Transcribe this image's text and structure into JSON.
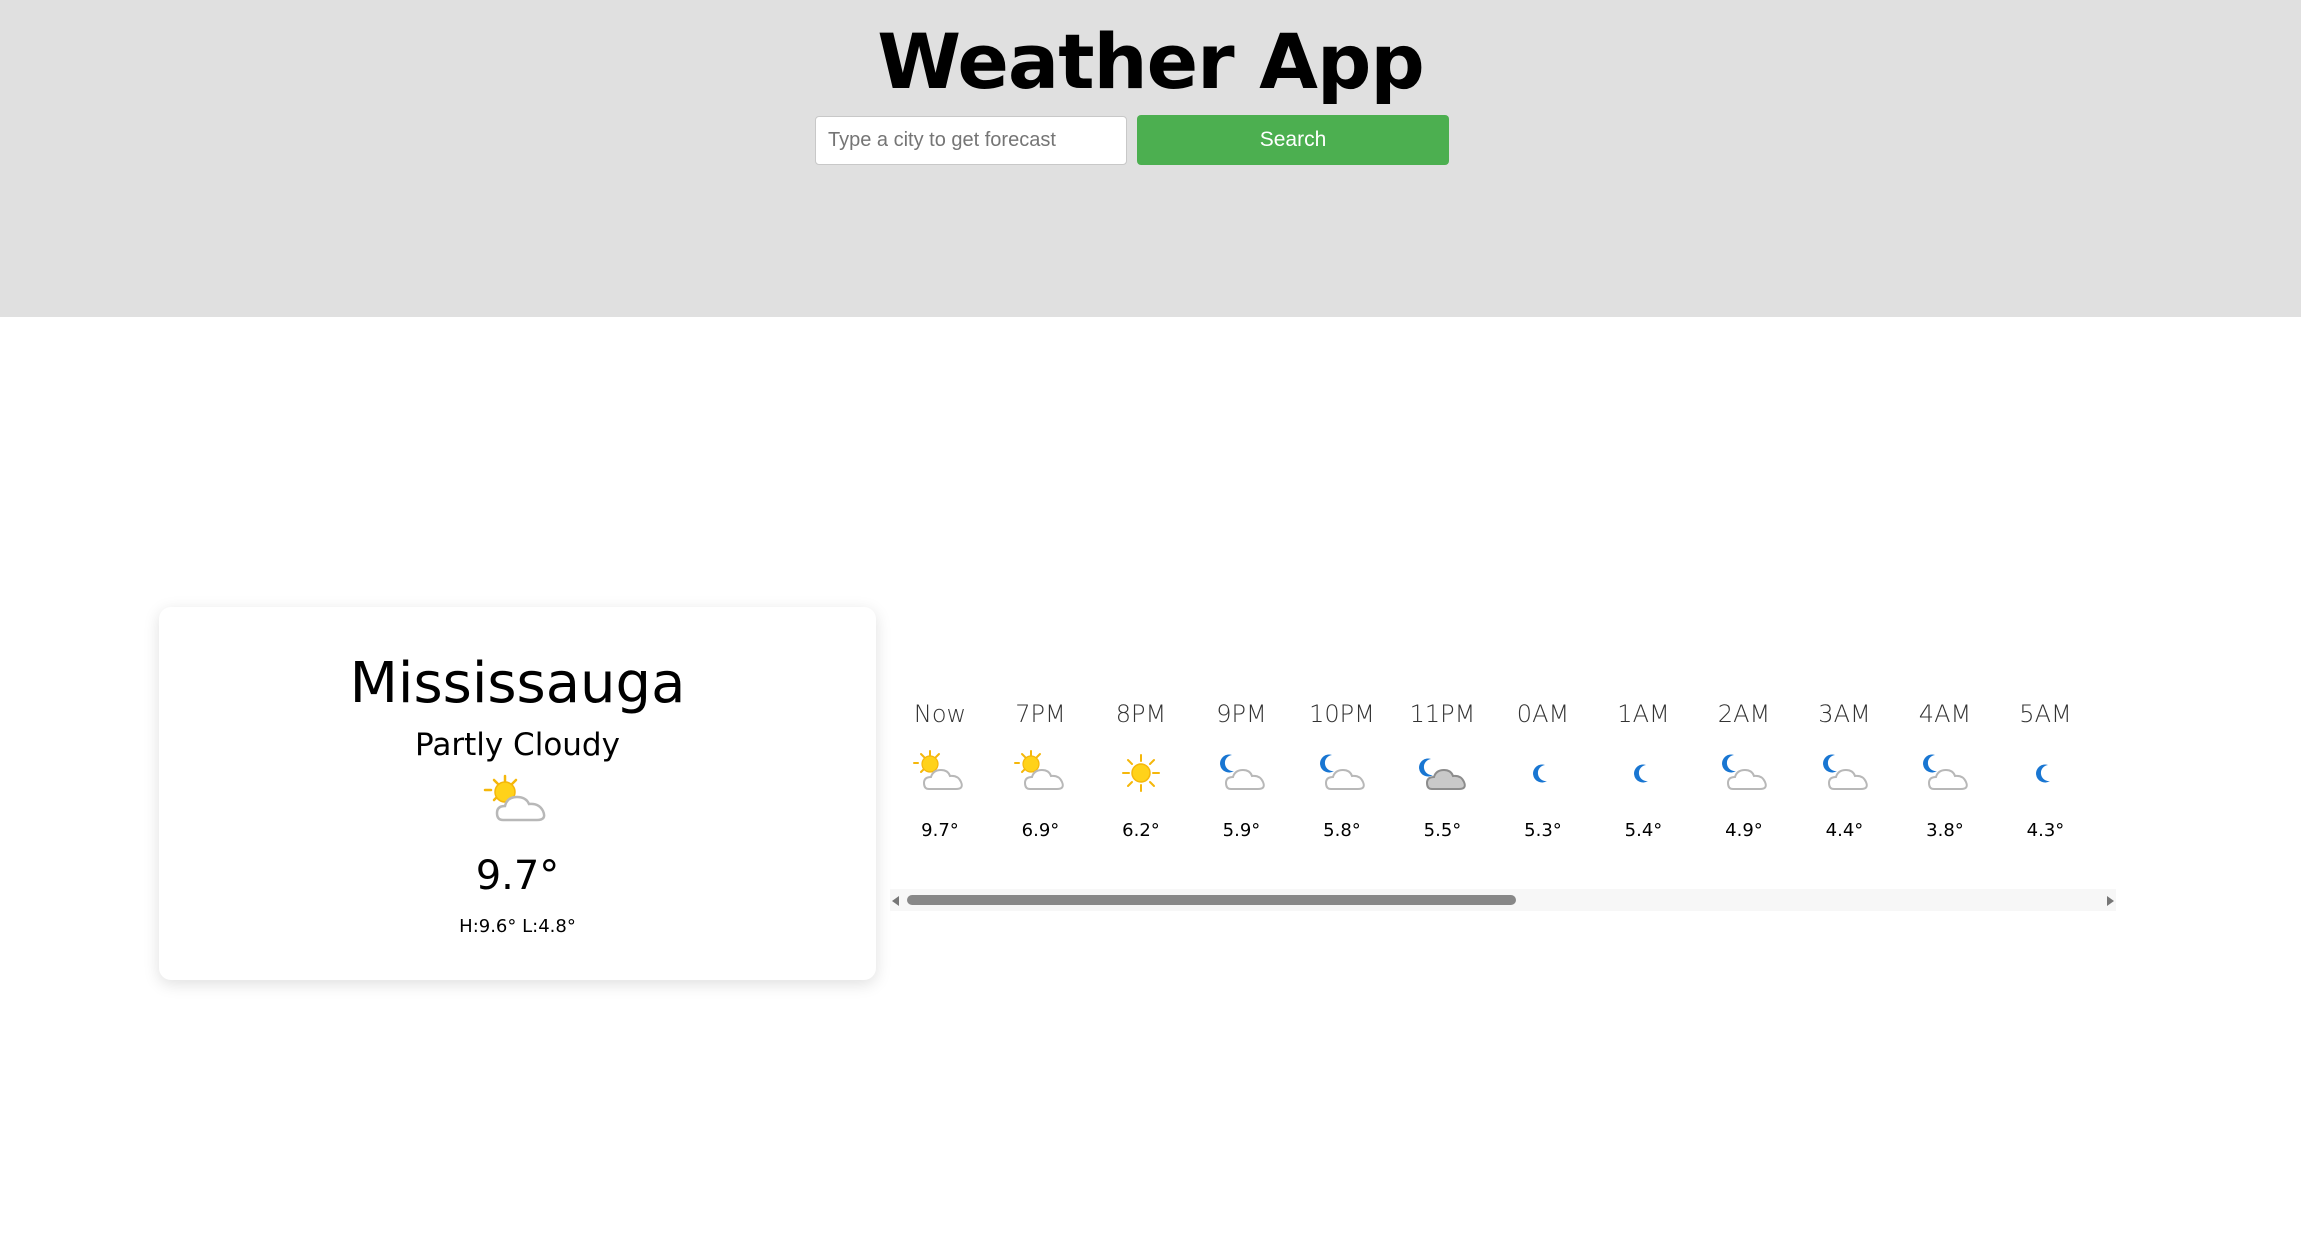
{
  "header": {
    "title": "Weather App",
    "search_placeholder": "Type a city to get forecast",
    "search_value": "",
    "search_button": "Search",
    "background_color": "#e0e0e0",
    "button_color": "#4caf50"
  },
  "current": {
    "city": "Mississauga",
    "condition": "Partly Cloudy",
    "icon": "partly-cloudy-day-icon",
    "temp": "9.7°",
    "hilo": "H:9.6° L:4.8°"
  },
  "hourly": [
    {
      "time": "Now",
      "icon": "partly-cloudy-day-icon",
      "temp": "9.7°"
    },
    {
      "time": "7PM",
      "icon": "partly-cloudy-day-icon",
      "temp": "6.9°"
    },
    {
      "time": "8PM",
      "icon": "sunny-icon",
      "temp": "6.2°"
    },
    {
      "time": "9PM",
      "icon": "partly-cloudy-night-icon",
      "temp": "5.9°"
    },
    {
      "time": "10PM",
      "icon": "partly-cloudy-night-icon",
      "temp": "5.8°"
    },
    {
      "time": "11PM",
      "icon": "cloudy-night-icon",
      "temp": "5.5°"
    },
    {
      "time": "0AM",
      "icon": "clear-night-icon",
      "temp": "5.3°"
    },
    {
      "time": "1AM",
      "icon": "clear-night-icon",
      "temp": "5.4°"
    },
    {
      "time": "2AM",
      "icon": "partly-cloudy-night-icon",
      "temp": "4.9°"
    },
    {
      "time": "3AM",
      "icon": "partly-cloudy-night-icon",
      "temp": "4.4°"
    },
    {
      "time": "4AM",
      "icon": "partly-cloudy-night-icon",
      "temp": "3.8°"
    },
    {
      "time": "5AM",
      "icon": "clear-night-icon",
      "temp": "4.3°"
    }
  ],
  "scroll_position": 0.0
}
